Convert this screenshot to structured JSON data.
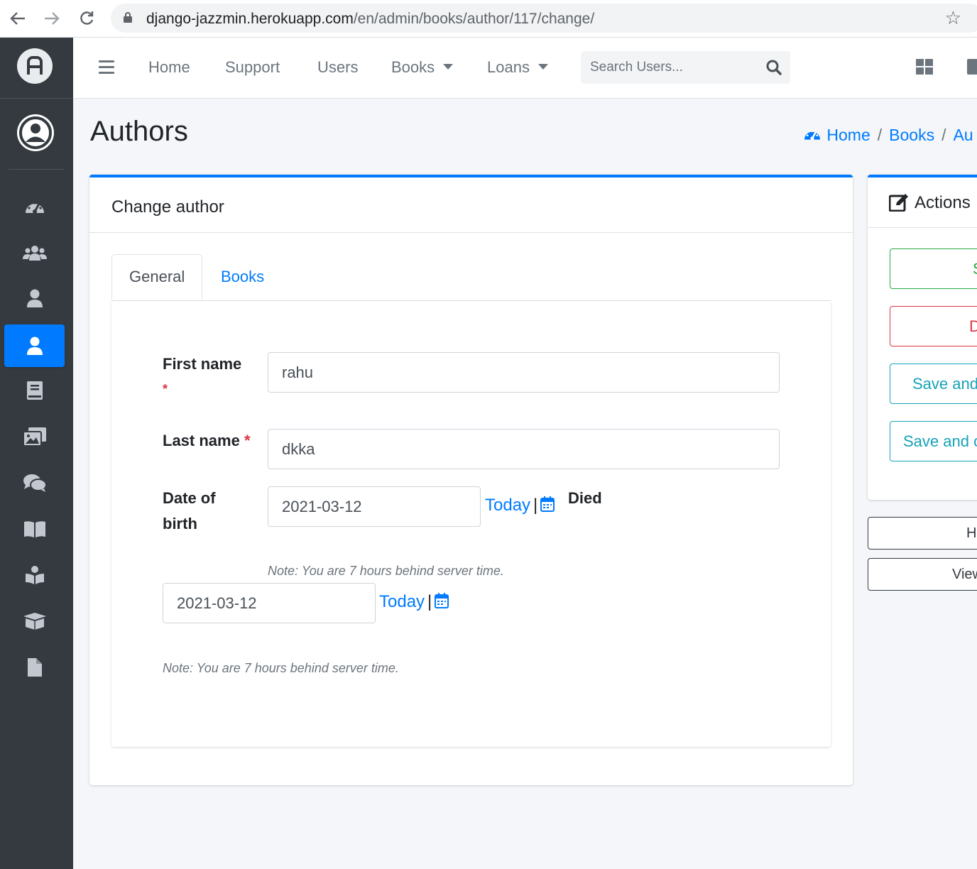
{
  "browser": {
    "url_host": "django-jazzmin.herokuapp.com",
    "url_path": "/en/admin/books/author/117/change/"
  },
  "sidebar": {
    "items": [
      {
        "icon": "tachometer-icon",
        "active": false
      },
      {
        "icon": "users-icon",
        "active": false
      },
      {
        "icon": "user-icon",
        "active": false
      },
      {
        "icon": "user-icon",
        "active": true
      },
      {
        "icon": "book-icon",
        "active": false
      },
      {
        "icon": "images-icon",
        "active": false
      },
      {
        "icon": "comments-icon",
        "active": false
      },
      {
        "icon": "book-open-icon",
        "active": false
      },
      {
        "icon": "book-reader-icon",
        "active": false
      },
      {
        "icon": "box-open-icon",
        "active": false
      },
      {
        "icon": "file-icon",
        "active": false
      }
    ]
  },
  "topnav": {
    "home": "Home",
    "support": "Support",
    "users": "Users",
    "books": "Books",
    "loans": "Loans",
    "search_placeholder": "Search Users..."
  },
  "page": {
    "title": "Authors",
    "breadcrumb": {
      "home": "Home",
      "books": "Books",
      "current": "Au"
    }
  },
  "form": {
    "card_title": "Change author",
    "tabs": {
      "general": "General",
      "books": "Books"
    },
    "first_name": {
      "label": "First name",
      "required_mark": "*",
      "value": "rahu"
    },
    "last_name": {
      "label": "Last name",
      "required_mark": "*",
      "value": "dkka"
    },
    "date_of_birth": {
      "label_line1": "Date of",
      "label_line2": "birth",
      "value": "2021-03-12",
      "today": "Today",
      "separator": "|",
      "note": "Note: You are 7 hours behind server time."
    },
    "died": {
      "label": "Died",
      "value": "2021-03-12",
      "today": "Today",
      "separator": "|",
      "note": "Note: You are 7 hours behind server time."
    }
  },
  "actions": {
    "title": "Actions",
    "buttons": {
      "save": "S",
      "delete": "D",
      "save_add": "Save and",
      "save_continue": "Save and c"
    },
    "history": "H",
    "view": "View"
  },
  "colors": {
    "primary": "#007bff",
    "sidebar": "#343a40",
    "success": "#28a745",
    "danger": "#dc3545",
    "info": "#17a2b8"
  }
}
